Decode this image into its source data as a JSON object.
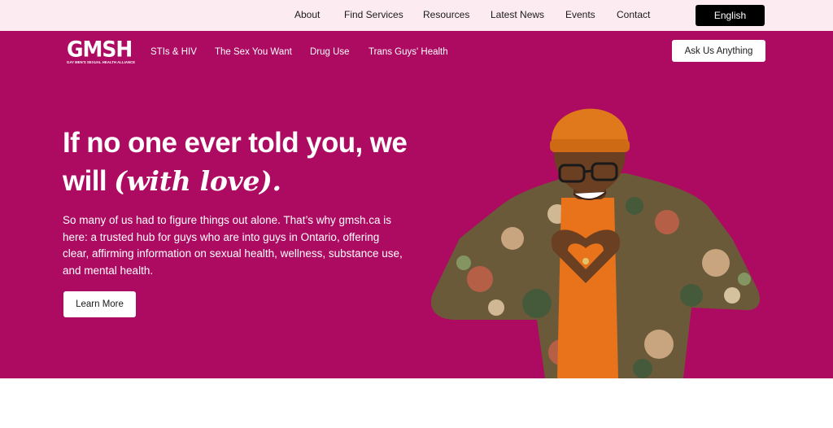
{
  "topbar": {
    "links": [
      "About",
      "Find Services",
      "Resources",
      "Latest News",
      "Events",
      "Contact"
    ],
    "language_button": "English"
  },
  "header": {
    "logo_text": "GMSH",
    "logo_tagline": "GAY MEN'S SEXUAL HEALTH ALLIANCE",
    "nav": [
      "STIs & HIV",
      "The Sex You Want",
      "Drug Use",
      "Trans Guys' Health"
    ],
    "cta_button": "Ask Us Anything"
  },
  "hero": {
    "headline_line1": "If no one ever told you, we",
    "headline_line2_prefix": "will ",
    "headline_emphasis": "(with love).",
    "body": "So many of us had to figure things out alone. That’s why gmsh.ca is here: a trusted hub for guys who are into guys in Ontario, offering clear, affirming information on sexual health, wellness, substance use, and mental health.",
    "button": "Learn More"
  },
  "colors": {
    "brand": "#ad0a61",
    "topbar_bg": "#fcecf1",
    "accent_orange": "#e8731a"
  }
}
